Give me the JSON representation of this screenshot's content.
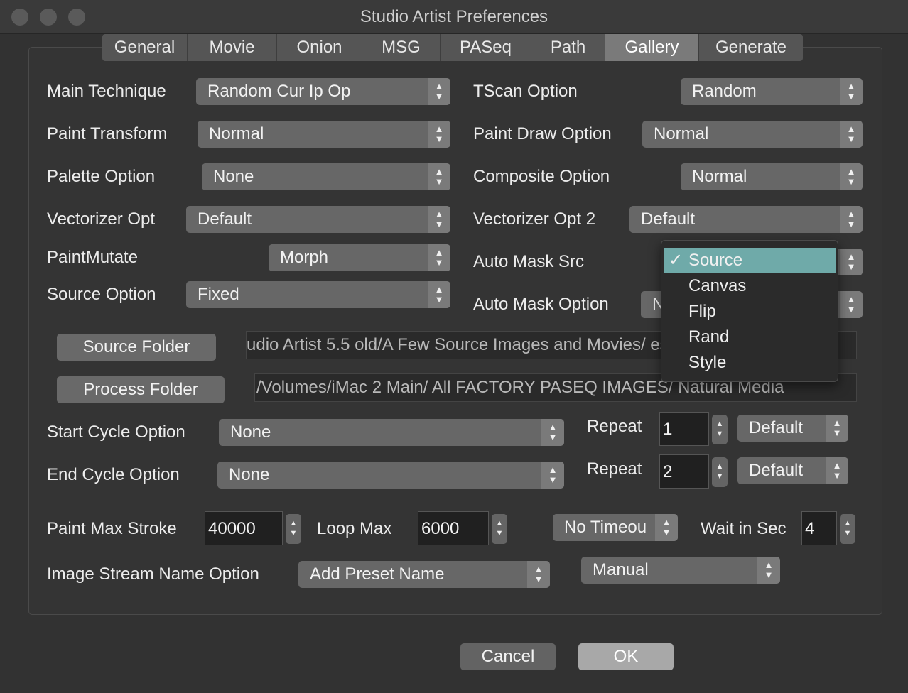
{
  "window": {
    "title": "Studio Artist Preferences"
  },
  "tabs": [
    {
      "label": "General"
    },
    {
      "label": "Movie"
    },
    {
      "label": "Onion"
    },
    {
      "label": "MSG"
    },
    {
      "label": "PASeq"
    },
    {
      "label": "Path"
    },
    {
      "label": "Gallery",
      "active": true
    },
    {
      "label": "Generate"
    }
  ],
  "left": {
    "main_technique": {
      "label": "Main Technique",
      "value": "Random Cur Ip Op"
    },
    "paint_transform": {
      "label": "Paint Transform",
      "value": "Normal"
    },
    "palette_option": {
      "label": "Palette Option",
      "value": "None"
    },
    "vectorizer_opt": {
      "label": "Vectorizer Opt",
      "value": "Default"
    },
    "paint_mutate": {
      "label": "PaintMutate",
      "value": "Morph"
    },
    "source_option": {
      "label": "Source Option",
      "value": "Fixed"
    }
  },
  "right": {
    "tscan_option": {
      "label": "TScan Option",
      "value": "Random"
    },
    "paint_draw_option": {
      "label": "Paint Draw Option",
      "value": "Normal"
    },
    "composite_option": {
      "label": "Composite Option",
      "value": "Normal"
    },
    "vectorizer_opt_2": {
      "label": "Vectorizer Opt 2",
      "value": "Default"
    },
    "auto_mask_src": {
      "label": "Auto Mask Src"
    },
    "auto_mask_option": {
      "label": "Auto Mask Option",
      "value": "N"
    }
  },
  "auto_mask_menu": {
    "items": [
      "Source",
      "Canvas",
      "Flip",
      "Rand",
      "Style"
    ],
    "selected": "Source",
    "check": "✓"
  },
  "folders": {
    "source_button": "Source Folder",
    "source_path": "udio Artist 5.5 old/A Few Source Images and Movies/        es",
    "process_button": "Process Folder",
    "process_path": "/Volumes/iMac 2 Main/    All FACTORY PASEQ IMAGES/  Natural Media"
  },
  "cycle": {
    "start": {
      "label": "Start Cycle Option",
      "value": "None",
      "repeat_label": "Repeat",
      "repeat_value": "1",
      "mode": "Default"
    },
    "end": {
      "label": "End Cycle Option",
      "value": "None",
      "repeat_label": "Repeat",
      "repeat_value": "2",
      "mode": "Default"
    }
  },
  "limits": {
    "paint_max_stroke_label": "Paint Max Stroke",
    "paint_max_stroke_value": "40000",
    "loop_max_label": "Loop Max",
    "loop_max_value": "6000",
    "timeout_value": "No Timeou",
    "wait_label": "Wait in Sec",
    "wait_value": "4"
  },
  "stream": {
    "label": "Image Stream Name Option",
    "value": "Add Preset Name",
    "mode": "Manual"
  },
  "footer": {
    "cancel": "Cancel",
    "ok": "OK"
  },
  "colors": {
    "menu_selection": "#6faaa9",
    "ok_button": "#a8a8a8"
  }
}
